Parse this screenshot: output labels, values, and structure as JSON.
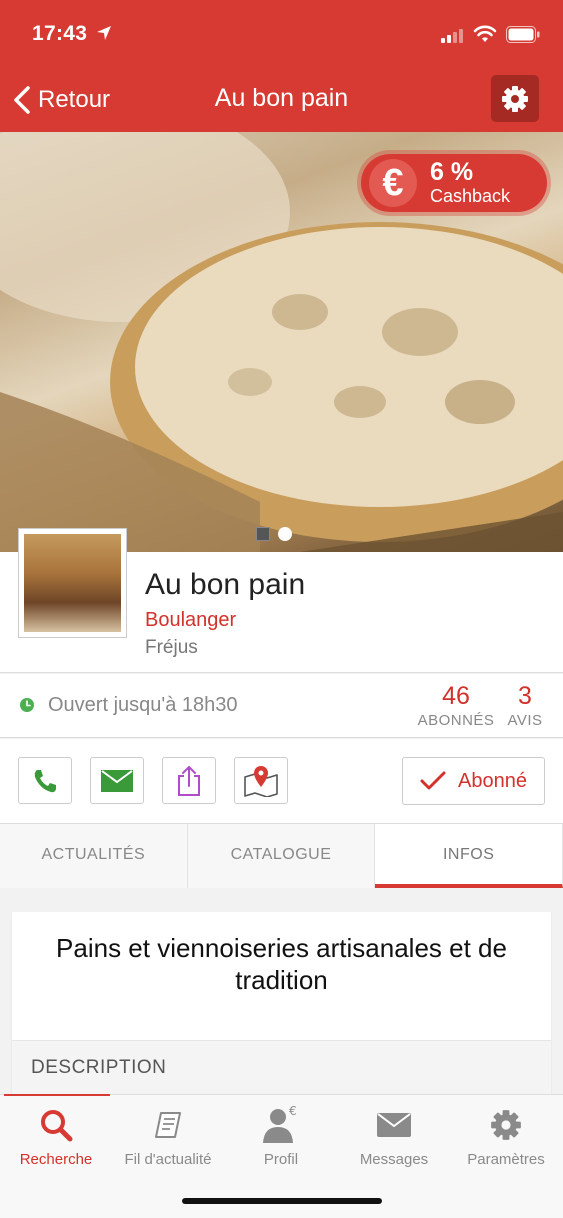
{
  "status_bar": {
    "time": "17:43"
  },
  "nav": {
    "back_label": "Retour",
    "title": "Au bon pain"
  },
  "hero": {
    "cashback_percent": "6 %",
    "cashback_label": "Cashback",
    "cashback_symbol": "€",
    "carousel_pages": 2,
    "carousel_active": 2
  },
  "business": {
    "name": "Au bon pain",
    "category": "Boulanger",
    "city": "Fréjus"
  },
  "stats": {
    "open_text": "Ouvert jusqu'à 18h30",
    "subscribers": {
      "value": "46",
      "label": "ABONNÉS"
    },
    "reviews": {
      "value": "3",
      "label": "AVIS"
    }
  },
  "actions": {
    "subscribe_label": "Abonné"
  },
  "tabs": [
    {
      "label": "ACTUALITÉS",
      "active": false
    },
    {
      "label": "CATALOGUE",
      "active": false
    },
    {
      "label": "INFOS",
      "active": true
    }
  ],
  "content": {
    "title": "Pains et viennoiseries artisanales et de tradition",
    "description_label": "DESCRIPTION"
  },
  "tabbar": [
    {
      "label": "Recherche",
      "icon": "search-icon",
      "active": true
    },
    {
      "label": "Fil d'actualité",
      "icon": "scroll-icon",
      "active": false
    },
    {
      "label": "Profil",
      "icon": "user-euro-icon",
      "active": false
    },
    {
      "label": "Messages",
      "icon": "envelope-icon",
      "active": false
    },
    {
      "label": "Paramètres",
      "icon": "gear-icon",
      "active": false
    }
  ],
  "colors": {
    "brand": "#d63a33",
    "open": "#4caf50",
    "phone": "#3a9a3a",
    "share": "#b04ccc"
  }
}
